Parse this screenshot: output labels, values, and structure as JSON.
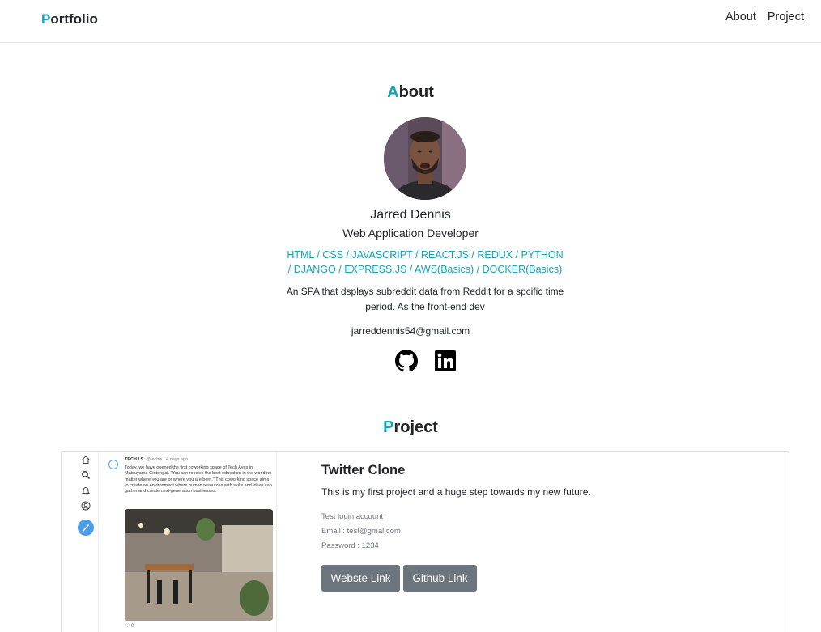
{
  "navbar": {
    "brand_first": "P",
    "brand_rest": "ortfolio",
    "links": [
      "About",
      "Project"
    ]
  },
  "about": {
    "title_first": "A",
    "title_rest": "bout",
    "name": "Jarred Dennis",
    "role": "Web Application Developer",
    "skills": "HTML / CSS / JAVASCRIPT / REACT.JS / REDUX / PYTHON / DJANGO / EXPRESS.JS / AWS(Basics) / DOCKER(Basics)",
    "description": "An SPA that dsplays subreddit data from Reddit for a spcific time period. As the front-end dev",
    "email": "jarreddennis54@gmail.com",
    "social_icons": [
      "github-icon",
      "linkedin-icon"
    ]
  },
  "project": {
    "title_first": "P",
    "title_rest": "roject",
    "cards": [
      {
        "title": "Twitter Clone",
        "text": "This is my first project and a huge step towards my new future.",
        "login_label": "Test login account",
        "login_email": "Email : test@gmal.com",
        "login_password": "Password : 1234",
        "site_button": "Webste Link",
        "github_button": "Github Link",
        "thumbnail": {
          "handle": "TECH I.S.",
          "handle_meta": "@techis · 4 days ago",
          "tweet_text": "Today, we have opened the first coworking space of Tech Ayes in Matsuyama Gintengai. \"You can receive the best education in the world no matter where you are or where you are born.\" This coworking space aims to create an environment where human resources with skills and ideas can gather and create next-generation businesses.",
          "like_count": "0"
        }
      }
    ]
  },
  "colors": {
    "accent": "#17a2b8",
    "button_bg": "#6c757d",
    "text": "#212529"
  }
}
